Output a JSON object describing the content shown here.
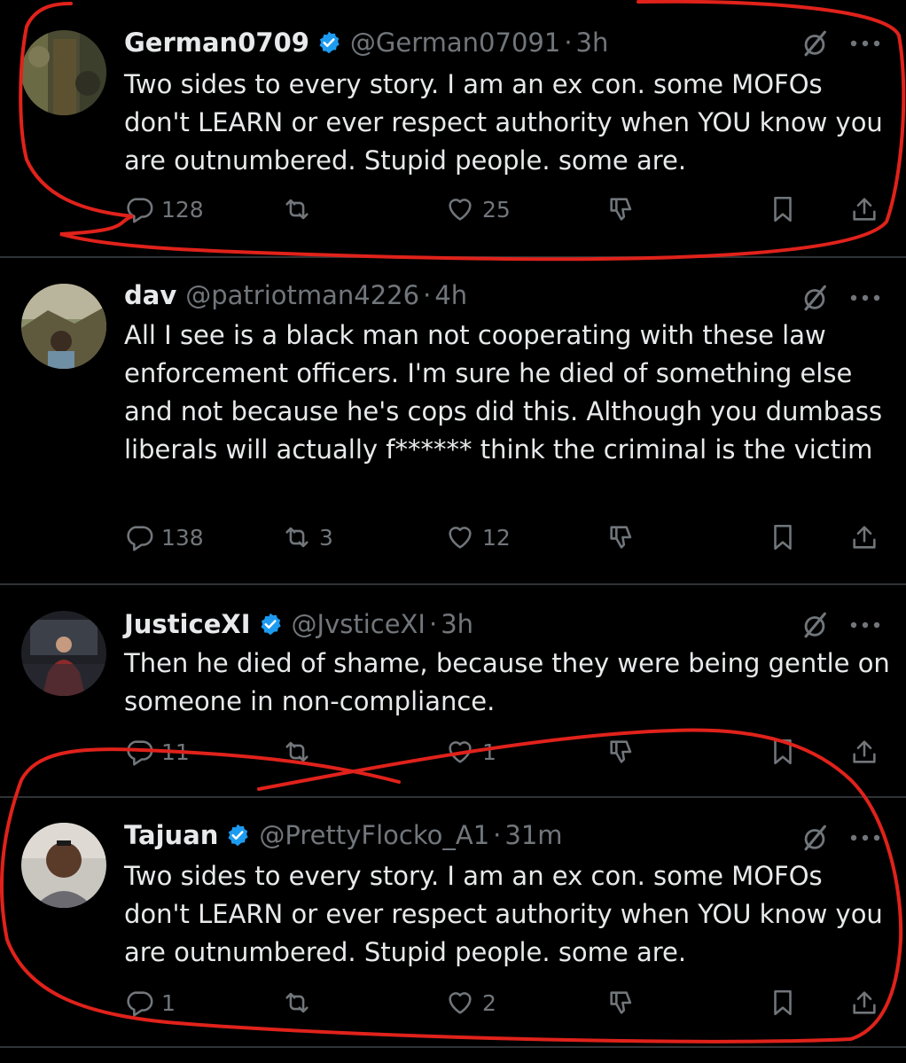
{
  "colors": {
    "background": "#000000",
    "text": "#e7e9ea",
    "muted": "#71767b",
    "verified": "#1d9bf0",
    "annotation": "#e0221b"
  },
  "icons": {
    "reply": "speech-bubble-icon",
    "retweet": "retweet-arrows-icon",
    "like": "heart-icon",
    "dislike": "thumbs-down-icon",
    "bookmark": "bookmark-icon",
    "share": "share-upload-icon",
    "grok": "grok-slash-icon",
    "more": "ellipsis-icon",
    "verified": "verified-badge-icon"
  },
  "tweets": [
    {
      "name": "German0709",
      "verified": true,
      "handle": "@German07091",
      "time": "3h",
      "text": "Two sides to every story.  I am an ex con. some MOFOs don't LEARN or ever respect authority when YOU know you are outnumbered.  Stupid people. some are.",
      "replies": "128",
      "retweets": "",
      "likes": "25"
    },
    {
      "name": "dav",
      "verified": false,
      "handle": "@patriotman4226",
      "time": "4h",
      "text": "All I see is a black man not cooperating with these law enforcement officers. I'm sure he died of something else and not because he's cops did this. Although you dumbass liberals will actually f****** think the criminal is the victim",
      "replies": "138",
      "retweets": "3",
      "likes": "12"
    },
    {
      "name": "JusticeXI",
      "verified": true,
      "handle": "@JvsticeXI",
      "time": "3h",
      "text": "Then he died of shame, because they were being gentle on someone in non-compliance.",
      "replies": "11",
      "retweets": "",
      "likes": "1"
    },
    {
      "name": "Tajuan",
      "verified": true,
      "handle": "@PrettyFlocko_A1",
      "time": "31m",
      "text": "Two sides to every story.  I am an ex con. some MOFOs don't LEARN or ever respect authority when YOU know you are outnumbered.  Stupid people. some are.",
      "replies": "1",
      "retweets": "",
      "likes": "2"
    }
  ],
  "separator": "·"
}
